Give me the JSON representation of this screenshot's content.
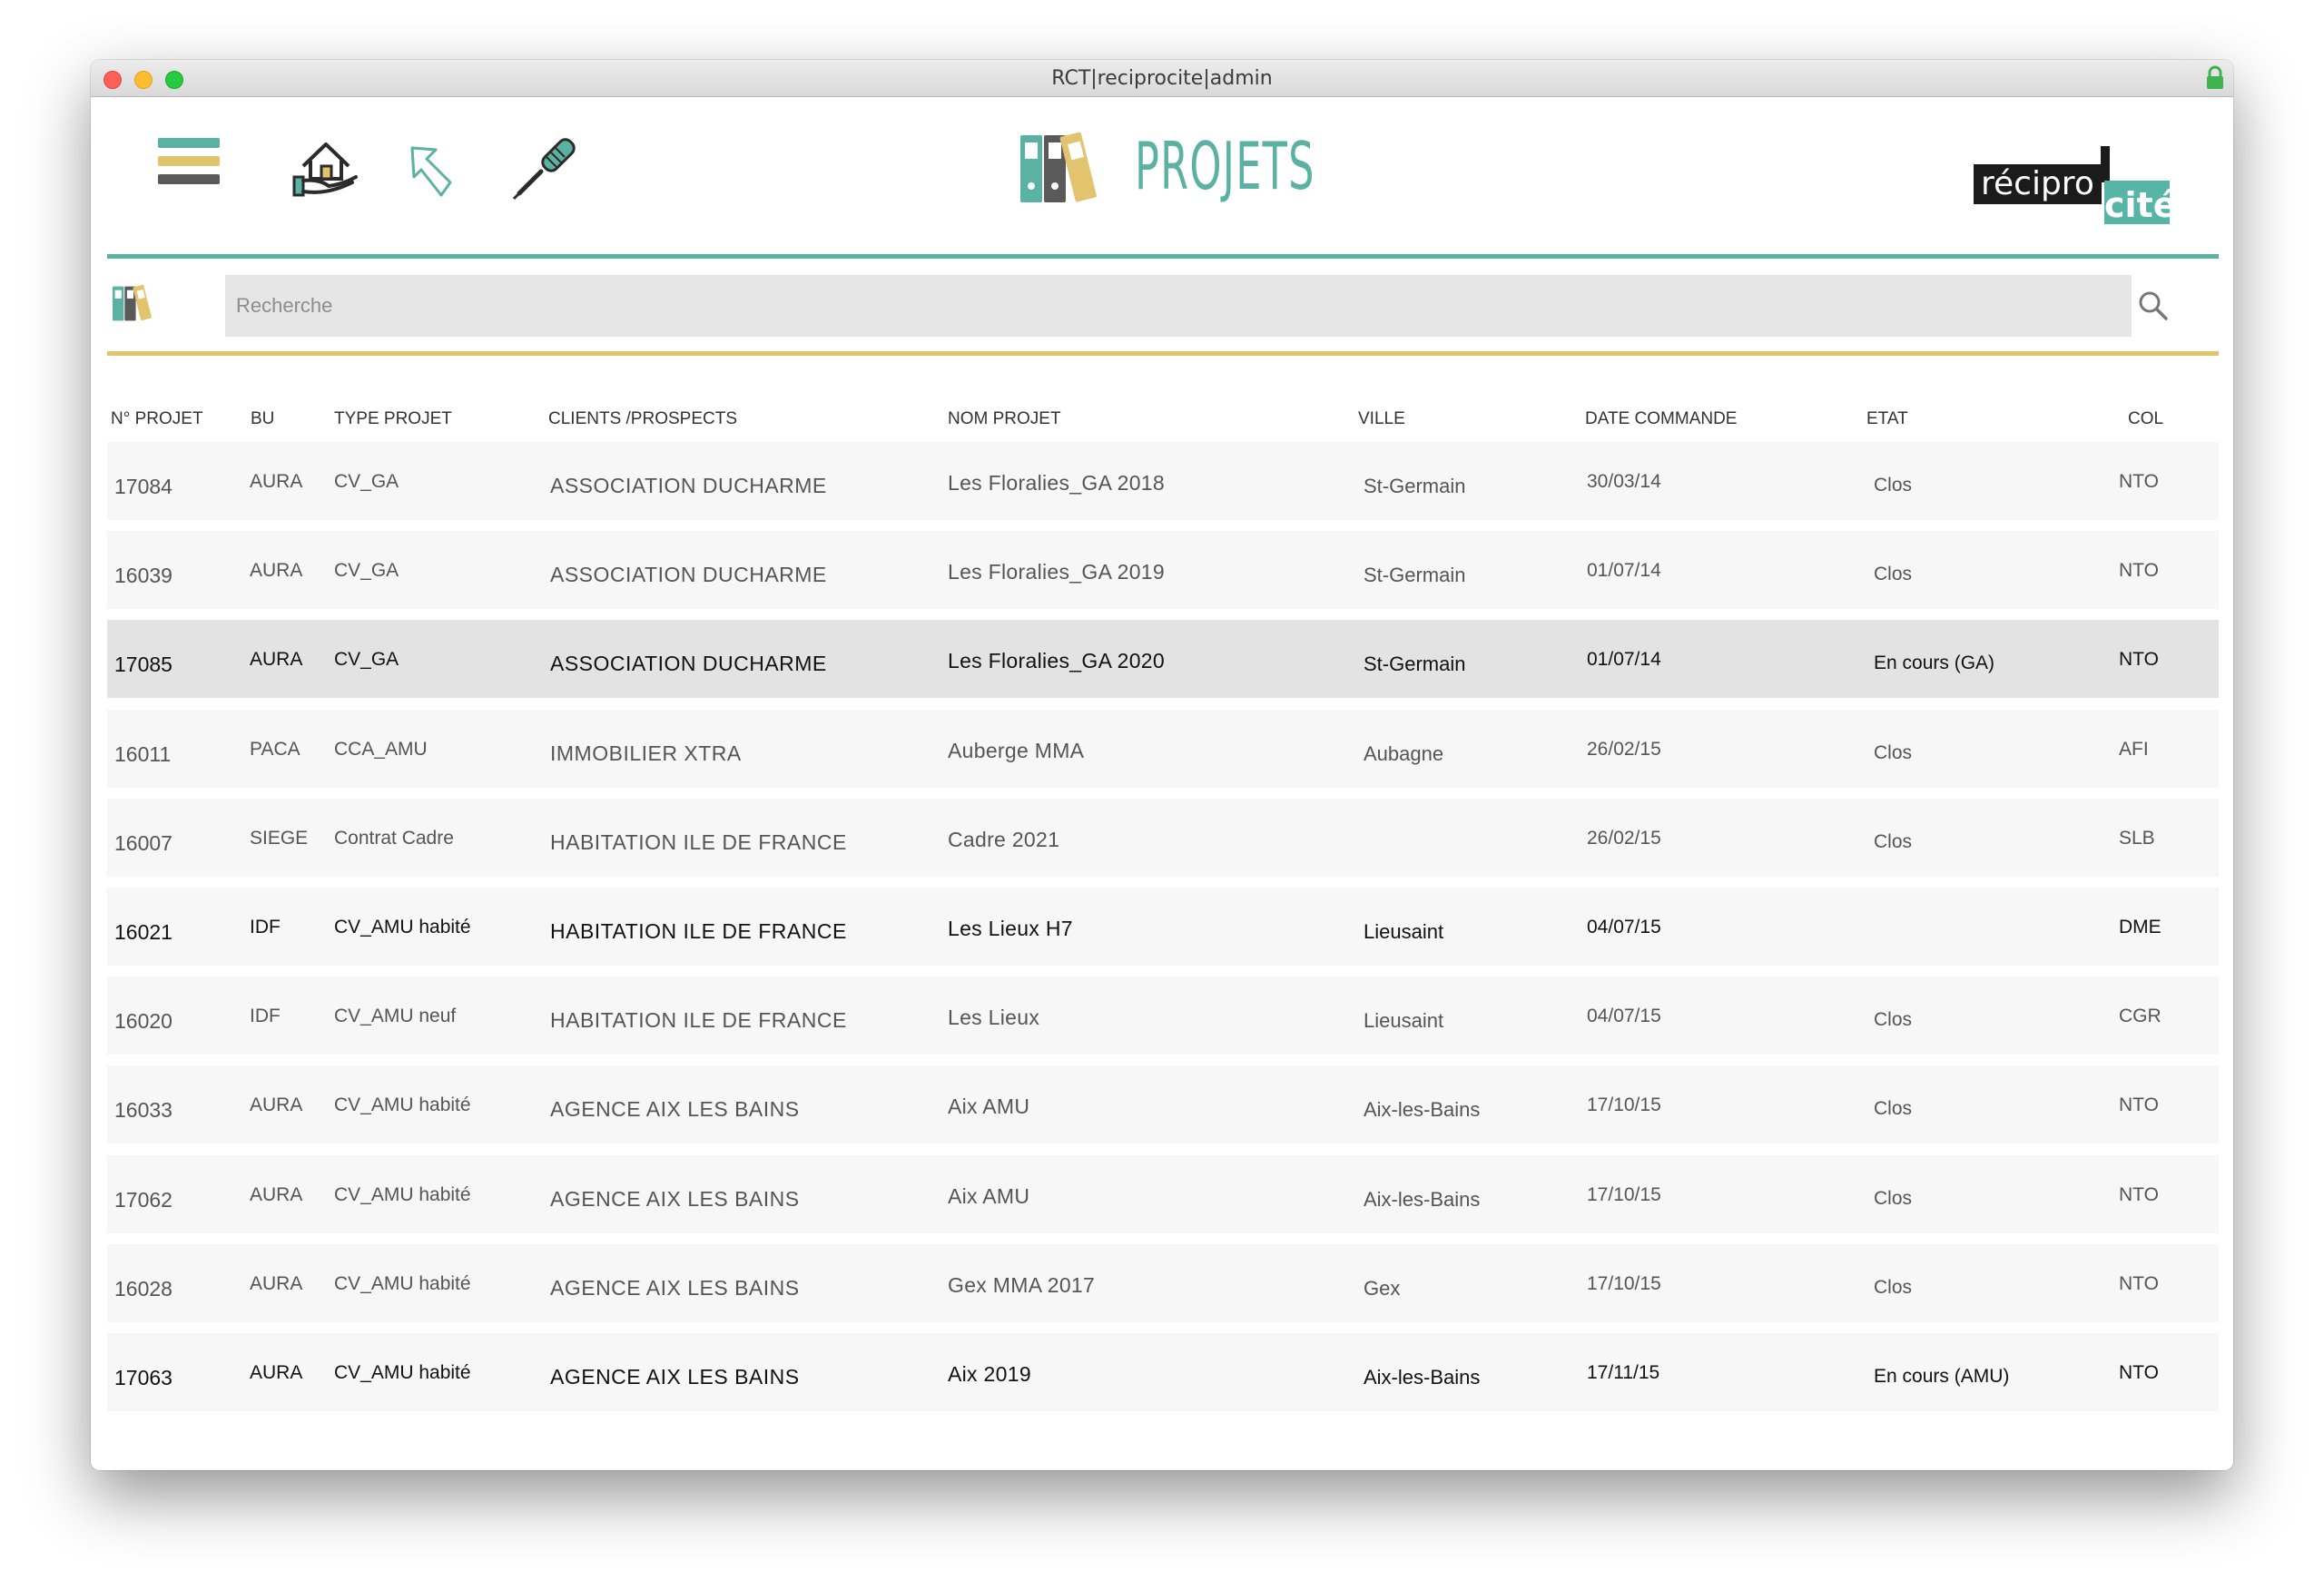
{
  "window": {
    "title": "RCT|reciprocite|admin"
  },
  "header": {
    "page_title": "PROJETS"
  },
  "logo": {
    "part1": "récipro",
    "part2": "cité"
  },
  "search": {
    "placeholder": "Recherche",
    "value": ""
  },
  "colors": {
    "teal": "#5bb2a3",
    "gold": "#e2c46e",
    "dark_gray": "#5a5a5a"
  },
  "icons": [
    "menu-icon",
    "home-icon",
    "back-arrow-icon",
    "screwdriver-icon",
    "binders-icon",
    "search-icon",
    "lock-icon"
  ],
  "table": {
    "columns": [
      "N° PROJET",
      "BU",
      "TYPE PROJET",
      "CLIENTS /PROSPECTS",
      "NOM PROJET",
      "VILLE",
      "DATE COMMANDE",
      "ETAT",
      "COL"
    ],
    "selected_row": 2,
    "rows": [
      {
        "num": "17084",
        "bu": "AURA",
        "type": "CV_GA",
        "client": "ASSOCIATION DUCHARME",
        "nom": "Les Floralies_GA 2018",
        "ville": "St-Germain",
        "date": "30/03/14",
        "etat": "Clos",
        "col": "NTO",
        "strong": false
      },
      {
        "num": "16039",
        "bu": "AURA",
        "type": "CV_GA",
        "client": "ASSOCIATION DUCHARME",
        "nom": "Les Floralies_GA 2019",
        "ville": "St-Germain",
        "date": "01/07/14",
        "etat": "Clos",
        "col": "NTO",
        "strong": false
      },
      {
        "num": "17085",
        "bu": "AURA",
        "type": "CV_GA",
        "client": "ASSOCIATION DUCHARME",
        "nom": "Les Floralies_GA 2020",
        "ville": "St-Germain",
        "date": "01/07/14",
        "etat": "En cours (GA)",
        "col": "NTO",
        "strong": true
      },
      {
        "num": "16011",
        "bu": "PACA",
        "type": "CCA_AMU",
        "client": "IMMOBILIER XTRA",
        "nom": "Auberge MMA",
        "ville": "Aubagne",
        "date": "26/02/15",
        "etat": "Clos",
        "col": "AFI",
        "strong": false
      },
      {
        "num": "16007",
        "bu": "SIEGE",
        "type": "Contrat Cadre",
        "client": "HABITATION ILE DE FRANCE",
        "nom": "Cadre 2021",
        "ville": "",
        "date": "26/02/15",
        "etat": "Clos",
        "col": "SLB",
        "strong": false
      },
      {
        "num": "16021",
        "bu": "IDF",
        "type": "CV_AMU habité",
        "client": "HABITATION ILE DE FRANCE",
        "nom": "Les Lieux H7",
        "ville": "Lieusaint",
        "date": "04/07/15",
        "etat": "",
        "col": "DME",
        "strong": true
      },
      {
        "num": "16020",
        "bu": "IDF",
        "type": "CV_AMU neuf",
        "client": "HABITATION ILE DE FRANCE",
        "nom": "Les Lieux",
        "ville": "Lieusaint",
        "date": "04/07/15",
        "etat": "Clos",
        "col": "CGR",
        "strong": false
      },
      {
        "num": "16033",
        "bu": "AURA",
        "type": "CV_AMU habité",
        "client": "AGENCE AIX LES BAINS",
        "nom": "Aix AMU",
        "ville": "Aix-les-Bains",
        "date": "17/10/15",
        "etat": "Clos",
        "col": "NTO",
        "strong": false
      },
      {
        "num": "17062",
        "bu": "AURA",
        "type": "CV_AMU habité",
        "client": "AGENCE AIX LES BAINS",
        "nom": "Aix AMU",
        "ville": "Aix-les-Bains",
        "date": "17/10/15",
        "etat": "Clos",
        "col": "NTO",
        "strong": false
      },
      {
        "num": "16028",
        "bu": "AURA",
        "type": "CV_AMU habité",
        "client": "AGENCE AIX LES BAINS",
        "nom": "Gex MMA 2017",
        "ville": "Gex",
        "date": "17/10/15",
        "etat": "Clos",
        "col": "NTO",
        "strong": false
      },
      {
        "num": "17063",
        "bu": "AURA",
        "type": "CV_AMU habité",
        "client": "AGENCE AIX LES BAINS",
        "nom": "Aix 2019",
        "ville": "Aix-les-Bains",
        "date": "17/11/15",
        "etat": "En cours (AMU)",
        "col": "NTO",
        "strong": true
      }
    ]
  }
}
